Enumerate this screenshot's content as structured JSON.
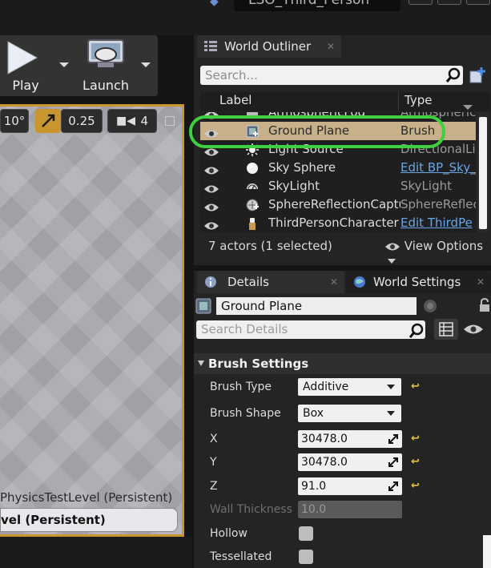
{
  "window": {
    "title": "LSO_Third_Person"
  },
  "toolbar": {
    "play_label": "Play",
    "launch_label": "Launch"
  },
  "viewport": {
    "rotation_snap": "10°",
    "scale_snap": "0.25",
    "camera_speed": "4",
    "level_label": "PhysicsTestLevel (Persistent)",
    "persistent_label": "vel (Persistent)"
  },
  "outliner": {
    "tab_label": "World Outliner",
    "search_placeholder": "Search...",
    "col_label": "Label",
    "col_type": "Type",
    "rows": [
      {
        "name": "AtmosphericFog",
        "type": "AtmosphericF",
        "icon": "fog-icon",
        "link": false,
        "selected": false
      },
      {
        "name": "Ground Plane",
        "type": "Brush",
        "icon": "brush-icon",
        "link": false,
        "selected": true
      },
      {
        "name": "Light Source",
        "type": "DirectionalLig",
        "icon": "sun-icon",
        "link": false,
        "selected": false
      },
      {
        "name": "Sky Sphere",
        "type": "Edit BP_Sky_",
        "icon": "sphere-icon",
        "link": true,
        "selected": false
      },
      {
        "name": "SkyLight",
        "type": "SkyLight",
        "icon": "skylight-icon",
        "link": false,
        "selected": false
      },
      {
        "name": "SphereReflectionCapture",
        "type": "SphereReflect",
        "icon": "reflection-icon",
        "link": false,
        "selected": false
      },
      {
        "name": "ThirdPersonCharacter",
        "type": "Edit ThirdPe",
        "icon": "character-icon",
        "link": true,
        "selected": false
      }
    ],
    "status": "7 actors (1 selected)",
    "view_options": "View Options"
  },
  "details": {
    "tab_label": "Details",
    "world_settings_tab": "World Settings",
    "actor_name": "Ground Plane",
    "search_placeholder": "Search Details",
    "section_title": "Brush Settings",
    "brush_type_label": "Brush Type",
    "brush_type_value": "Additive",
    "brush_shape_label": "Brush Shape",
    "brush_shape_value": "Box",
    "x_label": "X",
    "x_value": "30478.0",
    "y_label": "Y",
    "y_value": "30478.0",
    "z_label": "Z",
    "z_value": "91.0",
    "wall_label": "Wall Thickness",
    "wall_value": "10.0",
    "hollow_label": "Hollow",
    "tess_label": "Tessellated"
  },
  "colors": {
    "selection": "#c8b08a",
    "highlight": "#3fcf3f",
    "viewport_border": "#c8962e",
    "link": "#6aa6e6"
  }
}
